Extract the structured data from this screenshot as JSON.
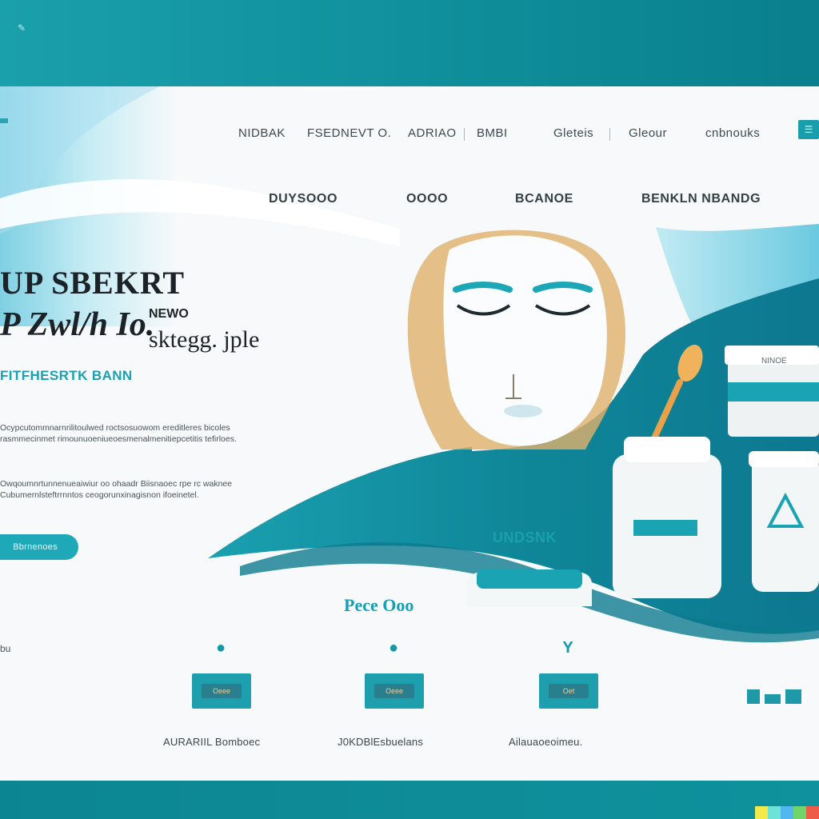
{
  "colors": {
    "teal_frame": "#0f8d9b",
    "accent": "#1aa0b0",
    "wave_dark": "#0f7f92",
    "wave_light": "#79cfe4",
    "page_bg": "#f7f9fa",
    "text_dark": "#1c2328"
  },
  "header": {
    "nav": [
      "NIDBAK",
      "FSEDNEVT O.",
      "ADRIAO",
      "BMBI",
      "Gleteis",
      "Gleour",
      "cnbnouks"
    ],
    "cta_icon": "menu-icon"
  },
  "subnav": [
    "DUYSOOO",
    "OOOO",
    "BCANOE",
    "BENKLN NBANDG"
  ],
  "hero": {
    "title_line1": "UP SBEKRT",
    "title_line2": "P Zwl/h Io.",
    "title_line2b": "sktegg. jple",
    "title_line2c": "NEWO",
    "accent": "FITFHESRTK BANN",
    "body_1": "Ocypcutommnarnrilitoulwed roctsosuowom ereditleres bicoles rasmmecinmet rimounuoeniueoesmenalmenitiepcetitis tefirloes.",
    "body_2": "Owqoumnrtunnenueaiwiur oo ohaadr Biisnaoec rpe rc waknee Cubumernlsteftrrnntos ceogorunxinagisnon ifoeinetel.",
    "cta": "Bbrnenoes"
  },
  "products": {
    "jar_label": "UNDSNK",
    "top_jar_label": "NINOE"
  },
  "features": {
    "heading": "Pece Ooo",
    "left_note": "bu",
    "items": [
      {
        "icon": "drop-icon",
        "card": "Oeee",
        "label": "AURARIIL Bomboec"
      },
      {
        "icon": "circle-icon",
        "card": "Oeee",
        "label": "J0KDBlEsbuelans"
      },
      {
        "icon": "y-icon",
        "card": "Oet",
        "label": "Ailauaoeoimeu."
      }
    ]
  }
}
